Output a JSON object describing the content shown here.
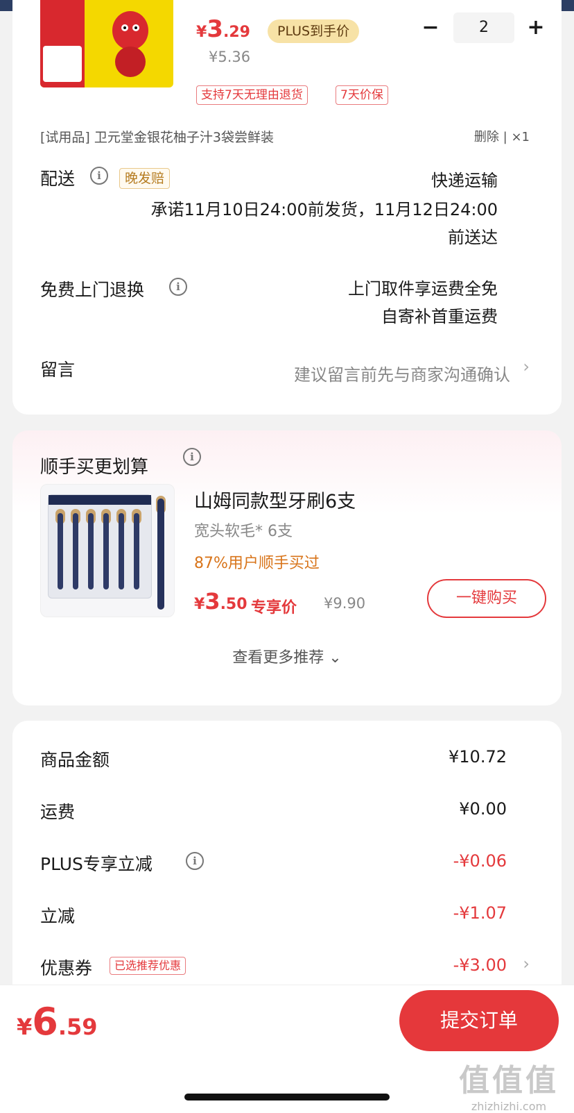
{
  "item": {
    "image_icon": "product-juice-image",
    "price_currency": "¥",
    "price_int": "3",
    "price_dec": ".29",
    "plus_label": "PLUS到手价",
    "original_price": "¥5.36",
    "quantity": "2",
    "minus_symbol": "−",
    "plus_symbol": "+",
    "badges": [
      "支持7天无理由退货",
      "7天价保"
    ]
  },
  "trial": {
    "text": "[试用品]  卫元堂金银花柚子汁3袋尝鲜装",
    "delete_label": "删除",
    "separator": "|",
    "qty": "×1"
  },
  "delivery": {
    "label": "配送",
    "late_badge": "晚发赔",
    "method": "快递运输",
    "promise_line1": "承诺11月10日24:00前发货，11月12日24:00",
    "promise_line2": "前送达"
  },
  "return_service": {
    "label": "免费上门退换",
    "line1": "上门取件享运费全免",
    "line2": "自寄补首重运费"
  },
  "message": {
    "label": "留言",
    "placeholder": "建议留言前先与商家沟通确认",
    "chevron": "›"
  },
  "upsell": {
    "title": "顺手买更划算",
    "product_name": "山姆同款型牙刷6支",
    "spec": "宽头软毛* 6支",
    "purchased_pct": "87%用户顺手买过",
    "price_currency": "¥",
    "price_int": "3",
    "price_dec": ".50",
    "exclusive_label": "专享价",
    "original_price": "¥9.90",
    "buy_button": "一键购买",
    "more_label": "查看更多推荐 ⌄"
  },
  "summary": {
    "rows": [
      {
        "label": "商品金额",
        "value": "¥10.72"
      },
      {
        "label": "运费",
        "value": "¥0.00"
      },
      {
        "label": "PLUS专享立减",
        "value": "-¥0.06"
      },
      {
        "label": "立减",
        "value": "-¥1.07"
      },
      {
        "label": "优惠券",
        "value": "-¥3.00"
      }
    ],
    "coupon_badge": "已选推荐优惠",
    "chevron": "›"
  },
  "footer": {
    "total_currency": "¥",
    "total_int": "6",
    "total_dec": ".59",
    "submit_label": "提交订单"
  },
  "watermark": {
    "big": "值值值",
    "site": "zhizhizhi.com"
  },
  "colors": {
    "accent": "#e4393c",
    "plus_badge": "#f7e2a6",
    "late_badge": "#b57b1f",
    "purchased": "#d8741a"
  }
}
